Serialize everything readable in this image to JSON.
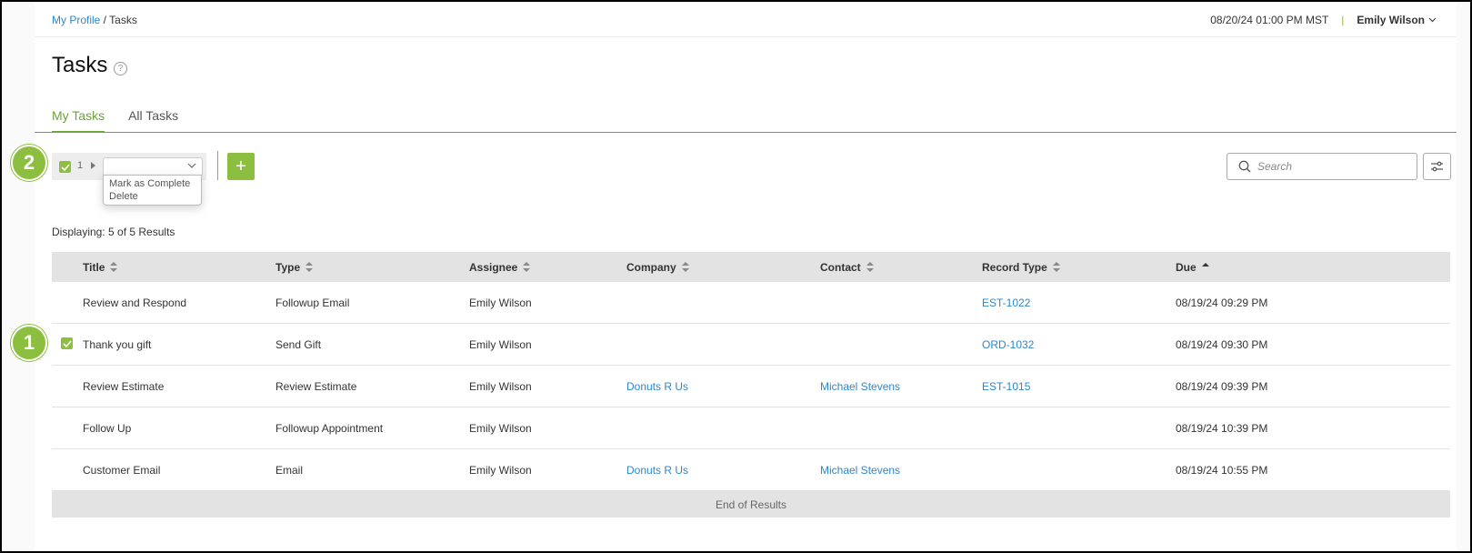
{
  "breadcrumb": {
    "parent": "My Profile",
    "separator": " / ",
    "current": "Tasks"
  },
  "header": {
    "datetime": "08/20/24 01:00 PM MST",
    "separator": "|",
    "user": "Emily Wilson"
  },
  "page": {
    "title": "Tasks",
    "help_glyph": "?"
  },
  "tabs": [
    {
      "label": "My Tasks",
      "active": true
    },
    {
      "label": "All Tasks",
      "active": false
    }
  ],
  "callouts": {
    "one": "1",
    "two": "2"
  },
  "bulk": {
    "selected_count": "1",
    "actions": [
      "Mark as Complete",
      "Delete"
    ]
  },
  "toolbar": {
    "add_glyph": "+"
  },
  "search": {
    "placeholder": "Search"
  },
  "results": {
    "text": "Displaying: 5 of 5 Results"
  },
  "table": {
    "columns": [
      "Title",
      "Type",
      "Assignee",
      "Company",
      "Contact",
      "Record Type",
      "Due"
    ],
    "rows": [
      {
        "checked": false,
        "title": "Review and Respond",
        "type": "Followup Email",
        "assignee": "Emily Wilson",
        "company": "",
        "contact": "",
        "record": "EST-1022",
        "due": "08/19/24 09:29 PM"
      },
      {
        "checked": true,
        "title": "Thank you gift",
        "type": "Send Gift",
        "assignee": "Emily Wilson",
        "company": "",
        "contact": "",
        "record": "ORD-1032",
        "due": "08/19/24 09:30 PM"
      },
      {
        "checked": false,
        "title": "Review Estimate",
        "type": "Review Estimate",
        "assignee": "Emily Wilson",
        "company": "Donuts R Us",
        "contact": "Michael Stevens",
        "record": "EST-1015",
        "due": "08/19/24 09:39 PM"
      },
      {
        "checked": false,
        "title": "Follow Up",
        "type": "Followup Appointment",
        "assignee": "Emily Wilson",
        "company": "",
        "contact": "",
        "record": "",
        "due": "08/19/24 10:39 PM"
      },
      {
        "checked": false,
        "title": "Customer Email",
        "type": "Email",
        "assignee": "Emily Wilson",
        "company": "Donuts R Us",
        "contact": "Michael Stevens",
        "record": "",
        "due": "08/19/24 10:55 PM"
      }
    ],
    "end_text": "End of Results"
  },
  "colors": {
    "accent": "#8cbf3f",
    "tab_active": "#6aa338",
    "link": "#2e87c8"
  }
}
